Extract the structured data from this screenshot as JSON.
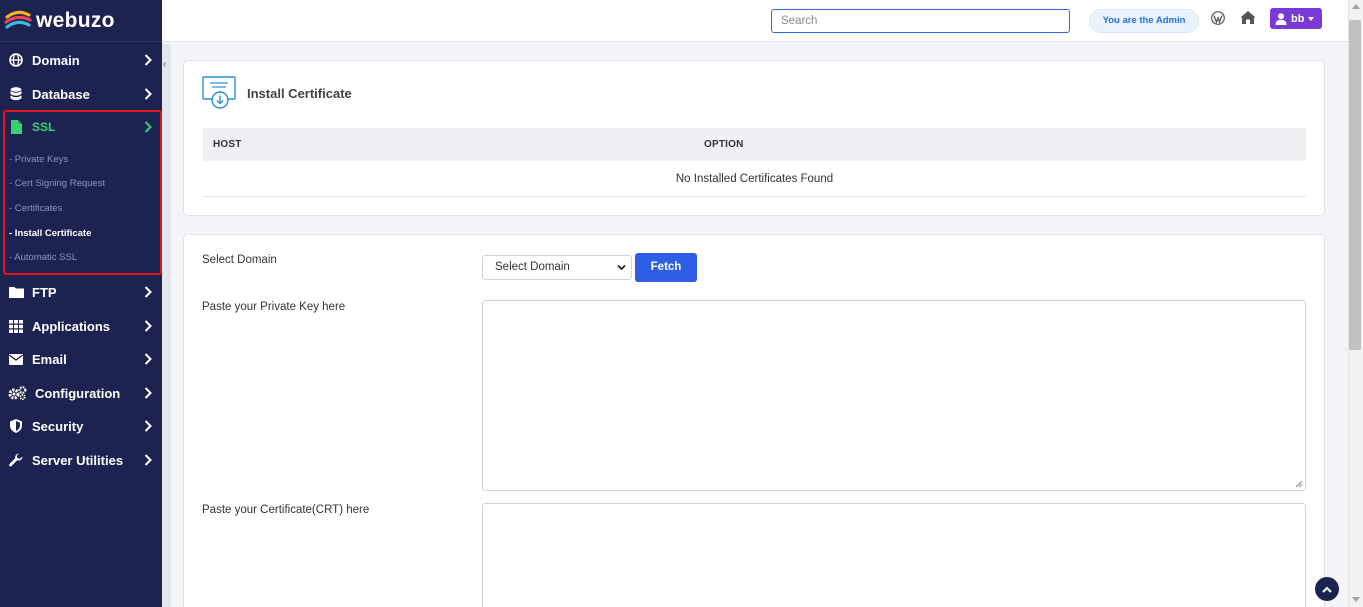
{
  "brand": {
    "name": "webuzo"
  },
  "sidebar": {
    "items": [
      {
        "label": "Domain",
        "icon": "globe-icon"
      },
      {
        "label": "Database",
        "icon": "database-icon"
      },
      {
        "label": "SSL",
        "icon": "file-icon"
      },
      {
        "label": "FTP",
        "icon": "folder-icon"
      },
      {
        "label": "Applications",
        "icon": "grid-icon"
      },
      {
        "label": "Email",
        "icon": "envelope-icon"
      },
      {
        "label": "Configuration",
        "icon": "cogs-icon"
      },
      {
        "label": "Security",
        "icon": "shield-icon"
      },
      {
        "label": "Server Utilities",
        "icon": "wrench-icon"
      }
    ],
    "ssl_submenu": [
      {
        "label": "- Private Keys",
        "active": false
      },
      {
        "label": "- Cert Signing Request",
        "active": false
      },
      {
        "label": "- Certificates",
        "active": false
      },
      {
        "label": "- Install Certificate",
        "active": true
      },
      {
        "label": "- Automatic SSL",
        "active": false
      }
    ]
  },
  "header": {
    "search_placeholder": "Search",
    "admin_badge": "You are the Admin",
    "user_label": "bb"
  },
  "installed_card": {
    "title": "Install Certificate",
    "columns": [
      "HOST",
      "OPTION"
    ],
    "empty_message": "No Installed Certificates Found"
  },
  "install_form": {
    "select_domain_label": "Select Domain",
    "select_domain_value": "Select Domain",
    "fetch_label": "Fetch",
    "private_key_label": "Paste your Private Key here",
    "certificate_label": "Paste your Certificate(CRT) here"
  },
  "colors": {
    "sidebar_bg": "#1c2351",
    "active_green": "#3ccf6d",
    "highlight_red": "#e0161e",
    "primary_blue": "#2f5ee6",
    "user_purple": "#7a3ad6"
  }
}
